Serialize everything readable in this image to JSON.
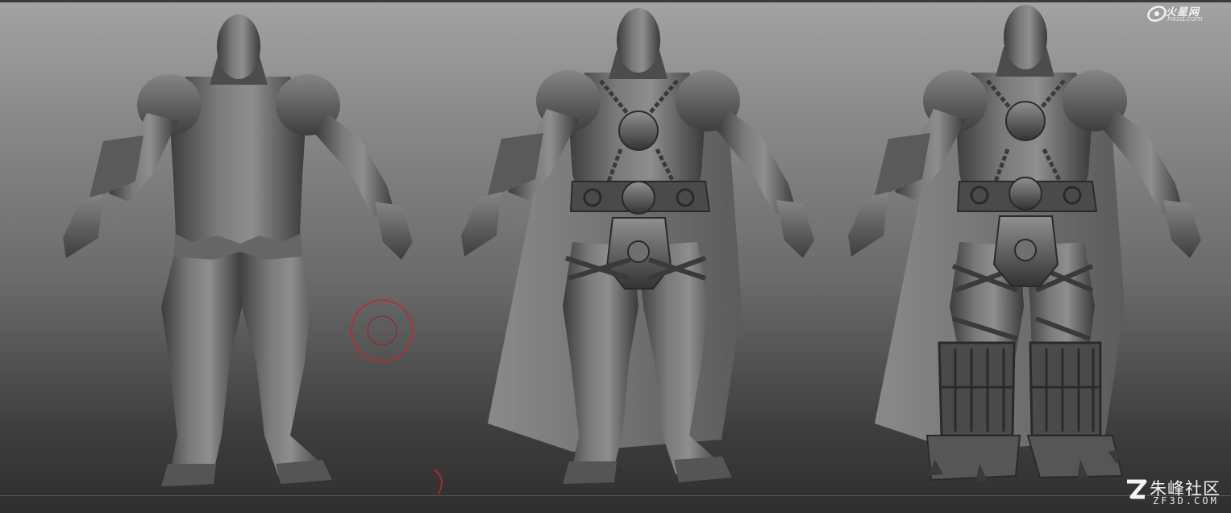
{
  "viewport": {
    "background_top": "#a3a3a3",
    "background_bottom": "#2f2f2f",
    "model_color": "#5e5e5e",
    "model_dark": "#2e2e2e",
    "model_light": "#9a9a9a",
    "cape_color": "#6c6c6c",
    "brush_color": "#c0272d"
  },
  "figures": [
    {
      "stage": "base-body"
    },
    {
      "stage": "armor-belt-cape"
    },
    {
      "stage": "full-armor-boots"
    }
  ],
  "watermarks": {
    "top_right": {
      "name": "火星网",
      "url": "hxsd.com"
    },
    "bottom_right": {
      "name": "朱峰社区",
      "url": "ZF3D.COM"
    }
  }
}
